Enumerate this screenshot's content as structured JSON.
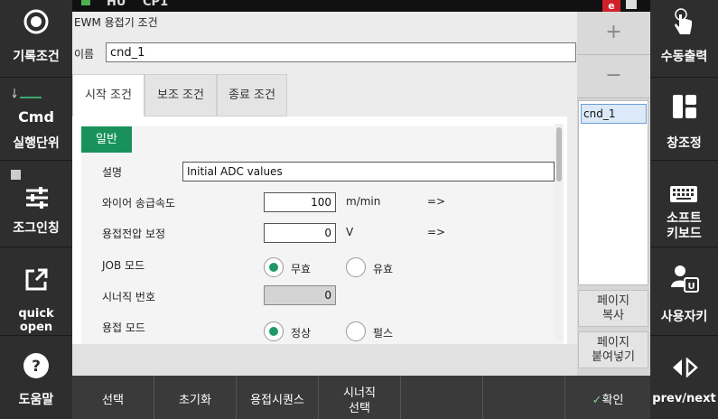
{
  "left_sidebar": [
    {
      "label": "기록조건",
      "icon": "record-circle-icon"
    },
    {
      "label_top": "Cmd",
      "label": "실행단위",
      "icon": "step-icon"
    },
    {
      "label": "조그인칭",
      "icon": "sliders-icon"
    },
    {
      "label": "quick open",
      "icon": "external-link-icon"
    },
    {
      "label": "도움말",
      "icon": "help-icon"
    }
  ],
  "right_sidebar": [
    {
      "label": "수동출력",
      "icon": "hand-touch-icon"
    },
    {
      "label": "창조정",
      "icon": "window-layout-icon"
    },
    {
      "label": "소프트\n키보드",
      "label1": "소프트",
      "label2": "키보드",
      "icon": "keyboard-icon"
    },
    {
      "label": "사용자키",
      "icon": "user-key-icon"
    },
    {
      "label": "prev/next",
      "icon": "prev-next-icon"
    }
  ],
  "status_strip": {
    "text1": "HU",
    "text2": "CP1",
    "badge": "e"
  },
  "window": {
    "title": "EWM 용접기 조건",
    "name_label": "이름",
    "name_value": "cnd_1"
  },
  "tabs": [
    "시작 조건",
    "보조 조건",
    "종료 조건"
  ],
  "section": {
    "badge": "일반",
    "description_label": "설명",
    "description_value": "Initial ADC values",
    "wire_speed_label": "와이어 송급속도",
    "wire_speed_value": "100",
    "wire_speed_unit": "m/min",
    "voltage_label": "용접전압 보정",
    "voltage_value": "0",
    "voltage_unit": "V",
    "arrow": "=>",
    "job_mode_label": "JOB 모드",
    "job_mode_options": [
      "무효",
      "유효"
    ],
    "synergic_label": "시너직 번호",
    "synergic_value": "0",
    "weld_mode_label": "용접 모드",
    "weld_mode_options": [
      "정상",
      "펄스"
    ]
  },
  "list": {
    "plus": "+",
    "minus": "−",
    "items": [
      "cnd_1"
    ],
    "copy_page": [
      "페이지",
      "복사"
    ],
    "paste_page": [
      "페이지",
      "붙여넣기"
    ]
  },
  "bottom_bar": {
    "select": "선택",
    "reset": "초기화",
    "weld_sequence": "용접시퀀스",
    "synergic_select": [
      "시너직",
      "선택"
    ],
    "confirm": "확인"
  },
  "colors": {
    "accent_green": "#18925a",
    "radio_on": "#1f9a66",
    "list_selected": "#dbe9f8"
  }
}
